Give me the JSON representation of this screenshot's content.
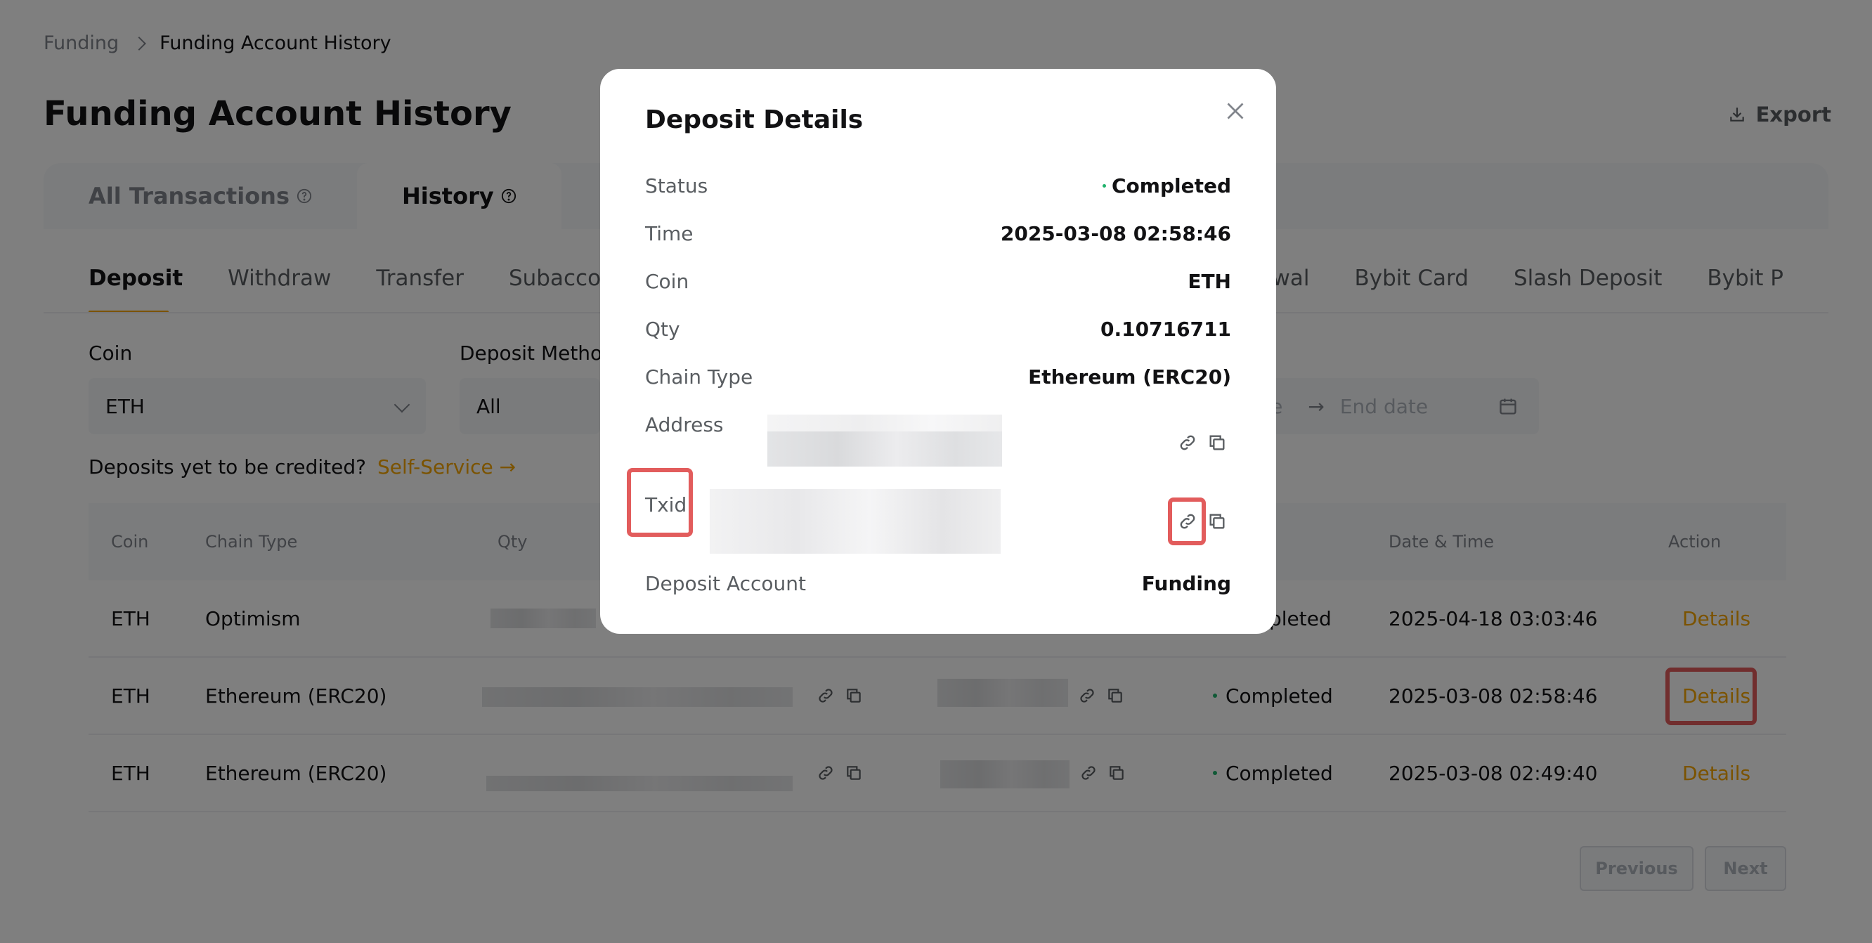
{
  "breadcrumb": {
    "parent": "Funding",
    "current": "Funding Account History"
  },
  "page": {
    "title": "Funding Account History",
    "export_label": "Export"
  },
  "top_tabs": [
    {
      "label": "All Transactions",
      "active": false
    },
    {
      "label": "History",
      "active": true
    }
  ],
  "sub_tabs": [
    {
      "label": "Deposit",
      "active": true
    },
    {
      "label": "Withdraw",
      "active": false
    },
    {
      "label": "Transfer",
      "active": false
    },
    {
      "label": "Subaccount",
      "active": false
    },
    {
      "label": "Withdrawal",
      "active": false
    },
    {
      "label": "Bybit Card",
      "active": false
    },
    {
      "label": "Slash Deposit",
      "active": false
    },
    {
      "label": "Bybit P",
      "active": false
    }
  ],
  "filters": {
    "coin_label": "Coin",
    "coin_value": "ETH",
    "method_label": "Deposit Method",
    "method_value": "All",
    "start_placeholder": "ate",
    "end_placeholder": "End date"
  },
  "hint": {
    "text": "Deposits yet to be credited?",
    "link": "Self-Service"
  },
  "table": {
    "headers": {
      "coin": "Coin",
      "chain": "Chain Type",
      "qty": "Qty",
      "datetime": "Date & Time",
      "action": "Action"
    },
    "rows": [
      {
        "coin": "ETH",
        "chain": "Optimism",
        "status": "Completed",
        "status_visible": "pleted",
        "datetime": "2025-04-18 03:03:46",
        "action": "Details"
      },
      {
        "coin": "ETH",
        "chain": "Ethereum (ERC20)",
        "status": "Completed",
        "status_visible": "Completed",
        "datetime": "2025-03-08 02:58:46",
        "action": "Details"
      },
      {
        "coin": "ETH",
        "chain": "Ethereum (ERC20)",
        "status": "Completed",
        "status_visible": "Completed",
        "datetime": "2025-03-08 02:49:40",
        "action": "Details"
      }
    ]
  },
  "pagination": {
    "previous": "Previous",
    "next": "Next"
  },
  "modal": {
    "title": "Deposit Details",
    "status_label": "Status",
    "status_value": "Completed",
    "time_label": "Time",
    "time_value": "2025-03-08 02:58:46",
    "coin_label": "Coin",
    "coin_value": "ETH",
    "qty_label": "Qty",
    "qty_value": "0.10716711",
    "chain_label": "Chain Type",
    "chain_value": "Ethereum (ERC20)",
    "address_label": "Address",
    "txid_label": "Txid",
    "account_label": "Deposit Account",
    "account_value": "Funding"
  },
  "colors": {
    "accent": "#f7a600",
    "success": "#20b26c",
    "highlight": "#e25c5c"
  }
}
